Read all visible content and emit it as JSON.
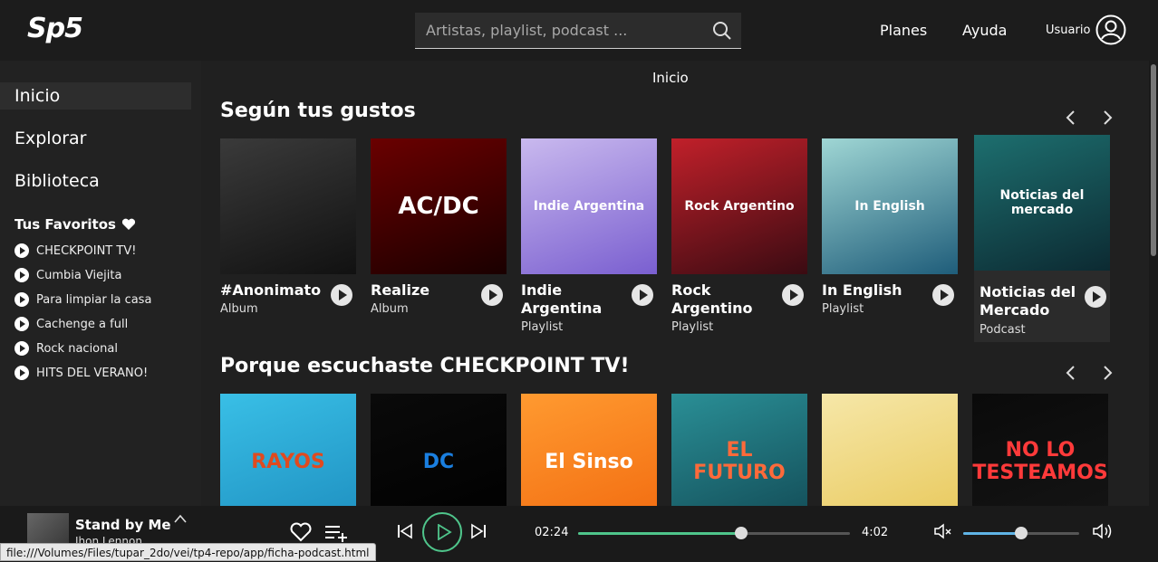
{
  "header": {
    "logo": "Sp5",
    "search_placeholder": "Artistas, playlist, podcast ...",
    "nav": [
      "Planes",
      "Ayuda"
    ],
    "user_label": "Usuario"
  },
  "sidebar": {
    "items": [
      {
        "label": "Inicio",
        "active": true
      },
      {
        "label": "Explorar",
        "active": false
      },
      {
        "label": "Biblioteca",
        "active": false
      }
    ],
    "favorites_title": "Tus Favoritos",
    "favorites": [
      "CHECKPOINT TV!",
      "Cumbia Viejita",
      "Para limpiar la casa",
      "Cachenge a full",
      "Rock nacional",
      "HITS DEL VERANO!"
    ]
  },
  "main": {
    "breadcrumb": "Inicio",
    "section1": {
      "title": "Según tus gustos",
      "cards": [
        {
          "title": "#Anonimato",
          "type": "Album",
          "cover_text": "",
          "colors": [
            "#3a3a3a",
            "#111111"
          ]
        },
        {
          "title": "Realize",
          "type": "Album",
          "cover_text": "AC/DC",
          "colors": [
            "#6a0000",
            "#1a0000"
          ]
        },
        {
          "title": "Indie Argentina",
          "type": "Playlist",
          "cover_text": "Indie Argentina",
          "colors": [
            "#c9b9ee",
            "#7a5fd0"
          ]
        },
        {
          "title": "Rock Argentino",
          "type": "Playlist",
          "cover_text": "Rock Argentino",
          "colors": [
            "#c1202a",
            "#3a0b12"
          ]
        },
        {
          "title": "In English",
          "type": "Playlist",
          "cover_text": "In English",
          "colors": [
            "#9fd6d4",
            "#1f5d7a"
          ]
        },
        {
          "title": "Noticias del Mercado",
          "type": "Podcast",
          "cover_text": "Noticias del mercado",
          "colors": [
            "#1d6f6f",
            "#0c2a32"
          ]
        }
      ]
    },
    "section2": {
      "title": "Porque escuchaste CHECKPOINT TV!",
      "cards": [
        {
          "cover_text": "RAYOS",
          "colors": [
            "#39bfe6",
            "#1e8fc0"
          ],
          "text_color": "#e04a1f"
        },
        {
          "cover_text": "DC",
          "colors": [
            "#0a0a0a",
            "#000000"
          ],
          "text_color": "#1a7fe0"
        },
        {
          "cover_text": "El Sinso",
          "colors": [
            "#ff9a30",
            "#f26b10"
          ],
          "text_color": "#ffffff"
        },
        {
          "cover_text": "EL FUTURO",
          "colors": [
            "#2a8f96",
            "#124a55"
          ],
          "text_color": "#ff6a3a"
        },
        {
          "cover_text": "",
          "colors": [
            "#f6e7a8",
            "#e8c85a"
          ],
          "text_color": "#333333"
        },
        {
          "cover_text": "NO LO TESTEAMOS",
          "colors": [
            "#0a0a0a",
            "#151515"
          ],
          "text_color": "#ff3a3a"
        }
      ]
    }
  },
  "player": {
    "track_title": "Stand by Me",
    "track_artist": "Jhon Lennon",
    "time_elapsed": "02:24",
    "time_total": "4:02",
    "progress": 0.6,
    "volume": 0.5,
    "accent_color": "#4fc58b",
    "volume_color": "#5fb4e6"
  },
  "status_url": "file:///Volumes/Files/tupar_2do/vei/tp4-repo/app/ficha-podcast.html"
}
